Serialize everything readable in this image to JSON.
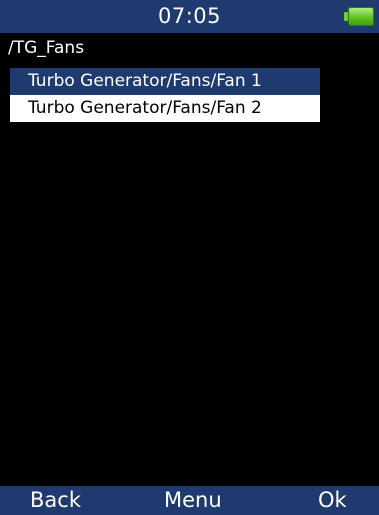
{
  "status_bar": {
    "time": "07:05",
    "battery_icon": "battery-full-icon",
    "bar_color": "#1e3a6e",
    "battery_color": "#5fc323"
  },
  "breadcrumb": "/TG_Fans",
  "list": {
    "items": [
      {
        "label": "Turbo Generator/Fans/Fan 1",
        "selected": true
      },
      {
        "label": "Turbo Generator/Fans/Fan 2",
        "selected": false
      }
    ]
  },
  "softkeys": {
    "left": "Back",
    "center": "Menu",
    "right": "Ok"
  }
}
